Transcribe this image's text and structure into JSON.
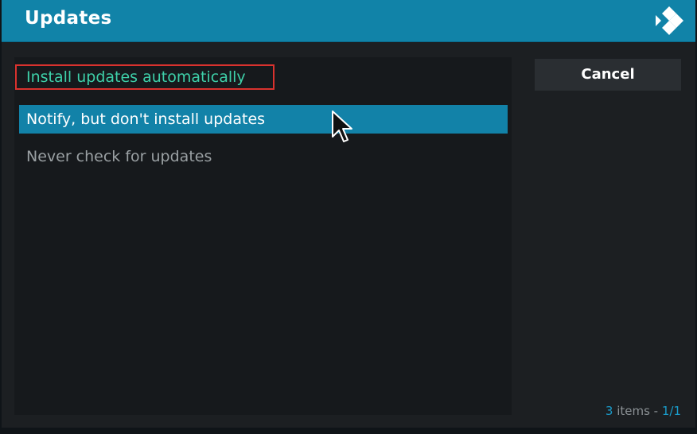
{
  "dialog": {
    "title": "Updates",
    "logo_icon": "kodi-logo-icon"
  },
  "options": [
    {
      "label": "Install updates automatically",
      "state": "current"
    },
    {
      "label": "Notify, but don't install updates",
      "state": "focused"
    },
    {
      "label": "Never check for updates",
      "state": "normal"
    }
  ],
  "buttons": {
    "cancel_label": "Cancel"
  },
  "footer": {
    "count": "3",
    "items_text": " items - ",
    "page": "1/1"
  },
  "colors": {
    "header": "#1183a8",
    "focused_item": "#1282a8",
    "current_item_text": "#3ed0a9",
    "annotation_box": "#d9322e"
  }
}
